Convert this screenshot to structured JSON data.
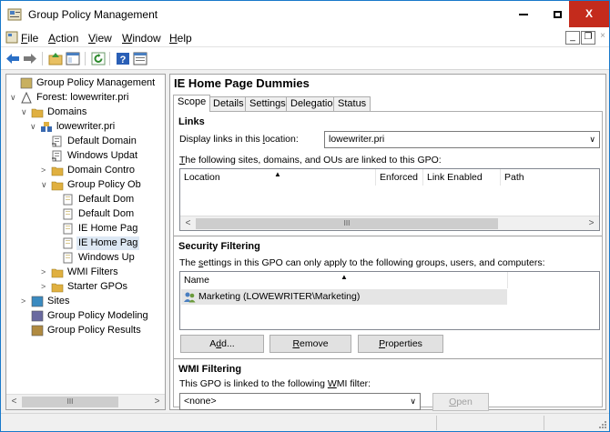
{
  "window": {
    "title": "Group Policy Management"
  },
  "menu": {
    "items": [
      "File",
      "Action",
      "View",
      "Window",
      "Help"
    ],
    "mdi_minimize": "_",
    "mdi_restore": "❐",
    "mdi_close": "×"
  },
  "titlebar": {
    "close_glyph": "X"
  },
  "toolbar": {
    "buttons": [
      "back-arrow-icon",
      "forward-arrow-icon",
      "up-folder-icon",
      "show-hide-tree-icon",
      "refresh-icon",
      "help-icon",
      "properties-icon"
    ]
  },
  "tree": {
    "items": [
      {
        "label": "Group Policy Management",
        "icon": "gpm-root-icon",
        "expander": ""
      },
      {
        "label": "Forest: lowewriter.pri",
        "icon": "forest-icon",
        "expander": "∨"
      },
      {
        "label": "Domains",
        "icon": "domains-folder-icon",
        "expander": "∨"
      },
      {
        "label": "lowewriter.pri",
        "icon": "domain-icon",
        "expander": "∨"
      },
      {
        "label": "Default Domain",
        "icon": "gpo-link-icon",
        "expander": ""
      },
      {
        "label": "Windows Updat",
        "icon": "gpo-link-icon",
        "expander": ""
      },
      {
        "label": "Domain Contro",
        "icon": "ou-icon",
        "expander": ">"
      },
      {
        "label": "Group Policy Ob",
        "icon": "gpo-folder-icon",
        "expander": "∨"
      },
      {
        "label": "Default Dom",
        "icon": "gpo-icon",
        "expander": ""
      },
      {
        "label": "Default Dom",
        "icon": "gpo-icon",
        "expander": ""
      },
      {
        "label": "IE Home Pag",
        "icon": "gpo-icon",
        "expander": ""
      },
      {
        "label": "IE Home Pag",
        "icon": "gpo-icon",
        "expander": ""
      },
      {
        "label": "Windows Up",
        "icon": "gpo-icon",
        "expander": ""
      },
      {
        "label": "WMI Filters",
        "icon": "wmi-folder-icon",
        "expander": ">"
      },
      {
        "label": "Starter GPOs",
        "icon": "starter-folder-icon",
        "expander": ">"
      },
      {
        "label": "Sites",
        "icon": "sites-icon",
        "expander": ">"
      },
      {
        "label": "Group Policy Modeling",
        "icon": "modeling-icon",
        "expander": ""
      },
      {
        "label": "Group Policy Results",
        "icon": "results-icon",
        "expander": ""
      }
    ],
    "selected_index": 11,
    "scroll_left": "<",
    "scroll_right": ">",
    "scroll_thumb": "III"
  },
  "gpo": {
    "title": "IE Home Page Dummies",
    "tabs": [
      "Scope",
      "Details",
      "Settings",
      "Delegation",
      "Status"
    ],
    "active_tab": "Scope",
    "links": {
      "heading": "Links",
      "display_label": "Display links in this location:",
      "location_value": "lowewriter.pri",
      "linked_text": "The following sites, domains, and OUs are linked to this GPO:",
      "columns": [
        "Location",
        "Enforced",
        "Link Enabled",
        "Path"
      ],
      "rows": [],
      "scroll_left": "<",
      "scroll_right": ">",
      "scroll_thumb": "III"
    },
    "security": {
      "heading": "Security Filtering",
      "description": "The settings in this GPO can only apply to the following groups, users, and computers:",
      "column": "Name",
      "rows": [
        "Marketing (LOWEWRITER\\Marketing)"
      ],
      "buttons": {
        "add": "Add...",
        "remove": "Remove",
        "properties": "Properties"
      }
    },
    "wmi": {
      "heading": "WMI Filtering",
      "description": "This GPO is linked to the following WMI filter:",
      "filter_value": "<none>",
      "open_button": "Open"
    }
  },
  "colors": {
    "accent": "#1979ca",
    "close": "#c42b1c",
    "selection": "#dde8f4"
  }
}
